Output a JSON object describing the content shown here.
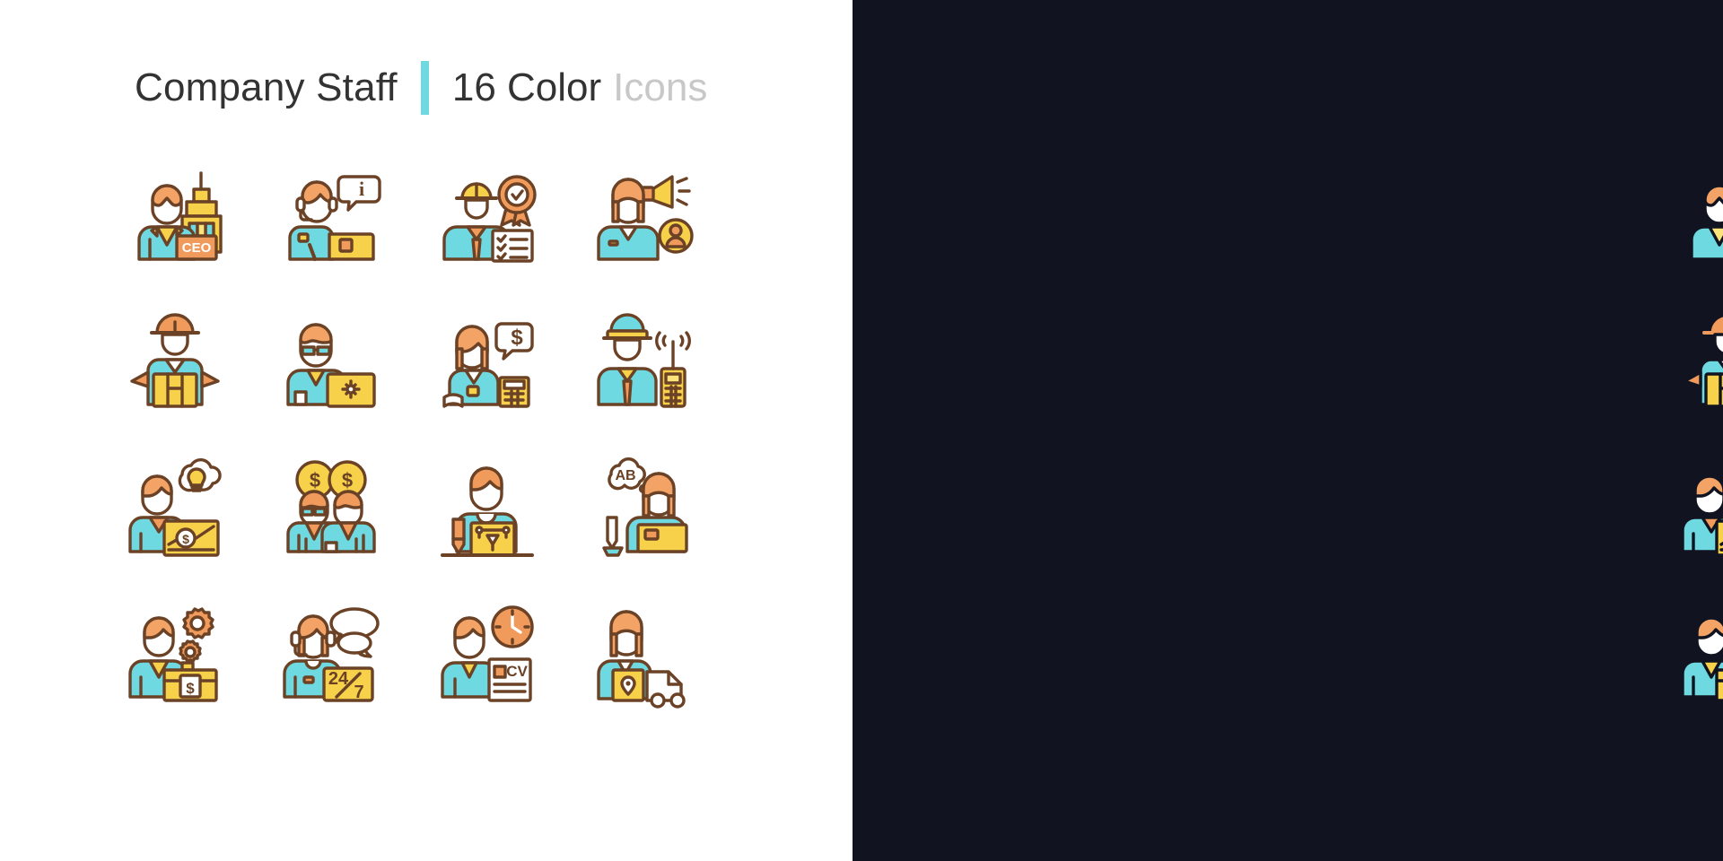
{
  "header": {
    "title": "Company Staff",
    "count_label": "16 Color",
    "suffix_label": "Icons",
    "divider_color": "#6ed9e0"
  },
  "palette": {
    "light_background": "#ffffff",
    "dark_background": "#111420",
    "stroke_light": "#6b4226",
    "stroke_dark": "#111420",
    "skin": "#ffffff",
    "hair_orange": "#f2a365",
    "cyan": "#6ed9e0",
    "yellow": "#f7d14a",
    "yellow_light": "#fbe27a",
    "orange": "#f09a5b",
    "white": "#ffffff",
    "title_text": "#333333",
    "title_muted": "#c8c8c8"
  },
  "icons": [
    {
      "id": "ceo",
      "name": "chief-executive-officer-icon",
      "label": "CEO",
      "row": 1,
      "col": 1
    },
    {
      "id": "support-agent",
      "name": "support-agent-icon",
      "label": "i",
      "row": 1,
      "col": 2
    },
    {
      "id": "quality-engineer",
      "name": "quality-engineer-icon",
      "label": "",
      "row": 1,
      "col": 3
    },
    {
      "id": "marketing",
      "name": "marketing-manager-icon",
      "label": "",
      "row": 1,
      "col": 4
    },
    {
      "id": "courier",
      "name": "courier-icon",
      "label": "",
      "row": 2,
      "col": 1
    },
    {
      "id": "it-specialist",
      "name": "it-specialist-icon",
      "label": "",
      "row": 2,
      "col": 2
    },
    {
      "id": "accountant",
      "name": "accountant-icon",
      "label": "$",
      "row": 2,
      "col": 3
    },
    {
      "id": "security-guard",
      "name": "security-guard-icon",
      "label": "",
      "row": 2,
      "col": 4
    },
    {
      "id": "analyst",
      "name": "business-analyst-icon",
      "label": "$",
      "row": 3,
      "col": 1
    },
    {
      "id": "sales-team",
      "name": "sales-team-icon",
      "label": "$ $",
      "row": 3,
      "col": 2
    },
    {
      "id": "designer",
      "name": "designer-icon",
      "label": "",
      "row": 3,
      "col": 3
    },
    {
      "id": "translator",
      "name": "translator-icon",
      "label": "AB",
      "row": 3,
      "col": 4
    },
    {
      "id": "operations",
      "name": "operations-manager-icon",
      "label": "$",
      "row": 4,
      "col": 1
    },
    {
      "id": "call-center",
      "name": "call-center-operator-icon",
      "label": "24/7",
      "row": 4,
      "col": 2
    },
    {
      "id": "recruiter",
      "name": "recruiter-icon",
      "label": "CV",
      "row": 4,
      "col": 3
    },
    {
      "id": "delivery-driver",
      "name": "delivery-driver-icon",
      "label": "",
      "row": 4,
      "col": 4
    }
  ],
  "labels": {
    "ceo": "CEO",
    "info": "i",
    "dollar": "$",
    "ab": "AB",
    "twentyfour": "24",
    "seven": "7",
    "cv": "CV"
  }
}
